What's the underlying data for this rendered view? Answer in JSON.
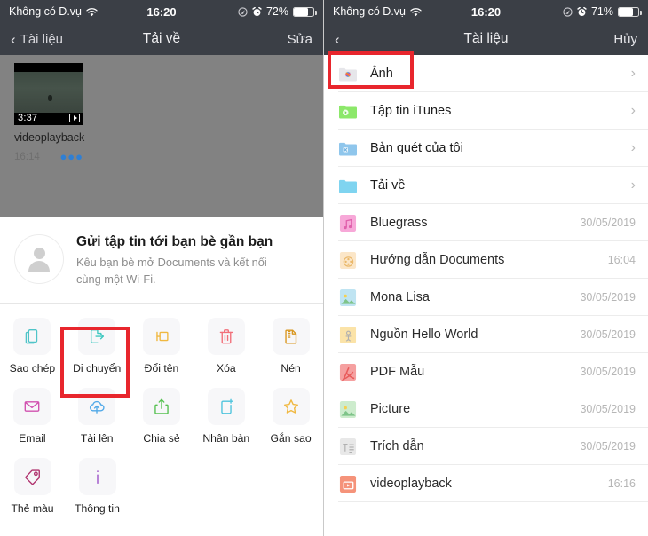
{
  "left_panel": {
    "statusbar": {
      "carrier": "Không có D.vụ",
      "wifi_icon": "wifi-icon",
      "time": "16:20",
      "location_icon": "location-icon",
      "alarm_icon": "alarm-clock-icon",
      "battery_text": "72%",
      "battery_level": 72
    },
    "navbar": {
      "back_label": "Tài liệu",
      "back_icon": "chevron-left-icon",
      "title": "Tải về",
      "action_label": "Sửa"
    },
    "file_card": {
      "duration": "3:37",
      "play_icon": "play-badge-icon",
      "name": "videoplayback",
      "time": "16:14",
      "more_icon": "more-dots-icon"
    },
    "share": {
      "avatar_icon": "person-avatar-icon",
      "title": "Gửi tập tin tới bạn bè gần bạn",
      "subtitle": "Kêu bạn bè mở Documents và kết nối cùng một Wi-Fi."
    },
    "actions": [
      [
        {
          "label": "Sao chép",
          "icon": "copy-icon",
          "color": "#4fc4c8",
          "highlighted": false
        },
        {
          "label": "Di chuyển",
          "icon": "move-icon",
          "color": "#3fc8c0",
          "highlighted": true
        },
        {
          "label": "Đổi tên",
          "icon": "rename-icon",
          "color": "#f0b841",
          "highlighted": false
        },
        {
          "label": "Xóa",
          "icon": "trash-icon",
          "color": "#f2707a",
          "highlighted": false
        },
        {
          "label": "Nén",
          "icon": "zip-icon",
          "color": "#d9971f",
          "highlighted": false
        }
      ],
      [
        {
          "label": "Email",
          "icon": "envelope-icon",
          "color": "#d152b0",
          "highlighted": false
        },
        {
          "label": "Tải lên",
          "icon": "cloud-upload-icon",
          "color": "#51a9e8",
          "highlighted": false
        },
        {
          "label": "Chia sẻ",
          "icon": "share-icon",
          "color": "#56c151",
          "highlighted": false
        },
        {
          "label": "Nhân bản",
          "icon": "duplicate-icon",
          "color": "#4fc4dd",
          "highlighted": false
        },
        {
          "label": "Gắn sao",
          "icon": "star-icon",
          "color": "#f0b841",
          "highlighted": false
        }
      ],
      [
        {
          "label": "Thẻ màu",
          "icon": "tag-icon",
          "color": "#b0336e",
          "highlighted": false
        },
        {
          "label": "Thông tin",
          "icon": "info-icon",
          "color": "#9b4fc8",
          "highlighted": false
        }
      ]
    ],
    "highlight_color": "#e8262d"
  },
  "right_panel": {
    "statusbar": {
      "carrier": "Không có D.vụ",
      "wifi_icon": "wifi-icon",
      "time": "16:20",
      "location_icon": "location-icon",
      "alarm_icon": "alarm-clock-icon",
      "battery_text": "71%",
      "battery_level": 71
    },
    "navbar": {
      "back_icon": "chevron-left-icon",
      "back_label": "",
      "title": "Tài liệu",
      "action_label": "Hủy"
    },
    "items": [
      {
        "label": "Ảnh",
        "icon": "photos-folder-icon",
        "kind": "folder",
        "color": "#e9e9ec",
        "date": "",
        "chevron": true,
        "highlighted": true
      },
      {
        "label": "Tập tin iTunes",
        "icon": "itunes-folder-icon",
        "kind": "folder",
        "color": "#8ce86a",
        "date": "",
        "chevron": true,
        "highlighted": false
      },
      {
        "label": "Bản quét của tôi",
        "icon": "scans-folder-icon",
        "kind": "folder",
        "color": "#8fc6ec",
        "date": "",
        "chevron": true,
        "highlighted": false
      },
      {
        "label": "Tải về",
        "icon": "downloads-folder-icon",
        "kind": "folder",
        "color": "#7fd4f0",
        "date": "",
        "chevron": true,
        "highlighted": false
      },
      {
        "label": "Bluegrass",
        "icon": "music-file-icon",
        "kind": "file",
        "color": "#f7a8d8",
        "date": "30/05/2019",
        "chevron": false,
        "highlighted": false
      },
      {
        "label": "Hướng dẫn Documents",
        "icon": "documents-guide-icon",
        "kind": "file",
        "color": "#fbe6c8",
        "date": "16:04",
        "chevron": false,
        "highlighted": false
      },
      {
        "label": "Mona Lisa",
        "icon": "image-file-icon",
        "kind": "file",
        "color": "#bfe4f2",
        "date": "30/05/2019",
        "chevron": false,
        "highlighted": false
      },
      {
        "label": "Nguồn Hello World",
        "icon": "source-file-icon",
        "kind": "file",
        "color": "#fbe3a8",
        "date": "30/05/2019",
        "chevron": false,
        "highlighted": false
      },
      {
        "label": "PDF Mẫu",
        "icon": "pdf-file-icon",
        "kind": "file",
        "color": "#f5a0a0",
        "date": "30/05/2019",
        "chevron": false,
        "highlighted": false
      },
      {
        "label": "Picture",
        "icon": "image-file-icon",
        "kind": "file",
        "color": "#cdeccd",
        "date": "30/05/2019",
        "chevron": false,
        "highlighted": false
      },
      {
        "label": "Trích dẫn",
        "icon": "text-file-icon",
        "kind": "file",
        "color": "#e8e8e8",
        "date": "30/05/2019",
        "chevron": false,
        "highlighted": false
      },
      {
        "label": "videoplayback",
        "icon": "video-file-icon",
        "kind": "file",
        "color": "#f5937a",
        "date": "16:16",
        "chevron": false,
        "highlighted": false
      }
    ],
    "highlight_color": "#e8262d"
  }
}
